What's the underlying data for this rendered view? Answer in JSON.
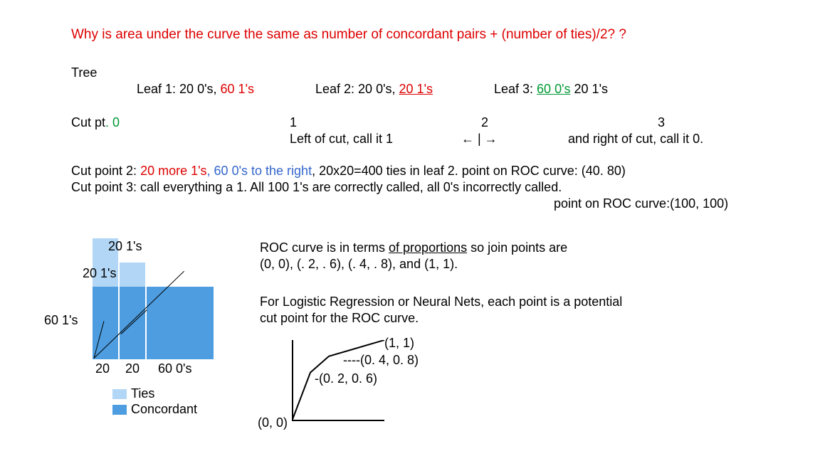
{
  "title": "Why is area under the curve the same as number of concordant pairs + (number of ties)/2? ?",
  "tree_label": "Tree",
  "leaf1_black": "Leaf 1:  20 0's, ",
  "leaf1_red": "60 1's",
  "leaf2_black": "Leaf 2:  20 0's, ",
  "leaf2_red": "20 1's",
  "leaf3_black": "Leaf 3:  ",
  "leaf3_green": "60 0's",
  "leaf3_rest": "  20 1's",
  "cutpt_black": "Cut pt",
  "cutpt_green": ". 0",
  "cut_row_1": "1",
  "cut_row_1b": "Left of cut, call it 1",
  "cut_row_2a": "2",
  "cut_row_2b": "←  |  →",
  "cut_row_3a": "3",
  "cut_row_3b": "and right of cut, call it 0.",
  "para_cut2_a": "Cut point 2: ",
  "para_cut2_b": "20 more 1's",
  "para_cut2_c": ", 60 0's to the right",
  "para_cut2_d": ", 20x20=400 ties in leaf 2.    point on ROC curve: (40. 80)",
  "para_cut3": "Cut point 3: call everything a 1. All 100 1's are correctly called, all 0's incorrectly called.",
  "para_cut3b": "point on ROC curve:(100, 100)",
  "right_p1a": "ROC curve is in terms ",
  "right_p1b": "of proportions",
  "right_p1c": " so join points are",
  "right_p2": "(0, 0), (. 2, . 6), (. 4, . 8), and (1, 1).",
  "right_p3": "For Logistic Regression or Neural Nets, each point is a potential",
  "right_p4": "cut point for the ROC curve.",
  "diag_lbl_20a": "20 1's",
  "diag_lbl_20b": "20 1's",
  "diag_lbl_60": "60  1's",
  "diag_x_20a": "20",
  "diag_x_20b": "20",
  "diag_x_60": "60  0's",
  "legend_ties": "Ties",
  "legend_conc": "Concordant",
  "roc_11": "(1, 1)",
  "roc_p48": "----(0. 4, 0. 8)",
  "roc_p26": "-(0. 2, 0. 6)",
  "roc_00": "(0, 0)",
  "colors": {
    "ties": "#b2d6f5",
    "conc": "#4d9de0"
  },
  "chart_data": {
    "type": "line",
    "title": "ROC curve",
    "x": [
      0,
      0.2,
      0.4,
      1
    ],
    "y": [
      0,
      0.6,
      0.8,
      1
    ],
    "xlabel": "",
    "ylabel": "",
    "xlim": [
      0,
      1
    ],
    "ylim": [
      0,
      1
    ],
    "annotations": [
      "(0, 0)",
      "(0.2, 0.6)",
      "(0.4, 0.8)",
      "(1, 1)"
    ]
  }
}
